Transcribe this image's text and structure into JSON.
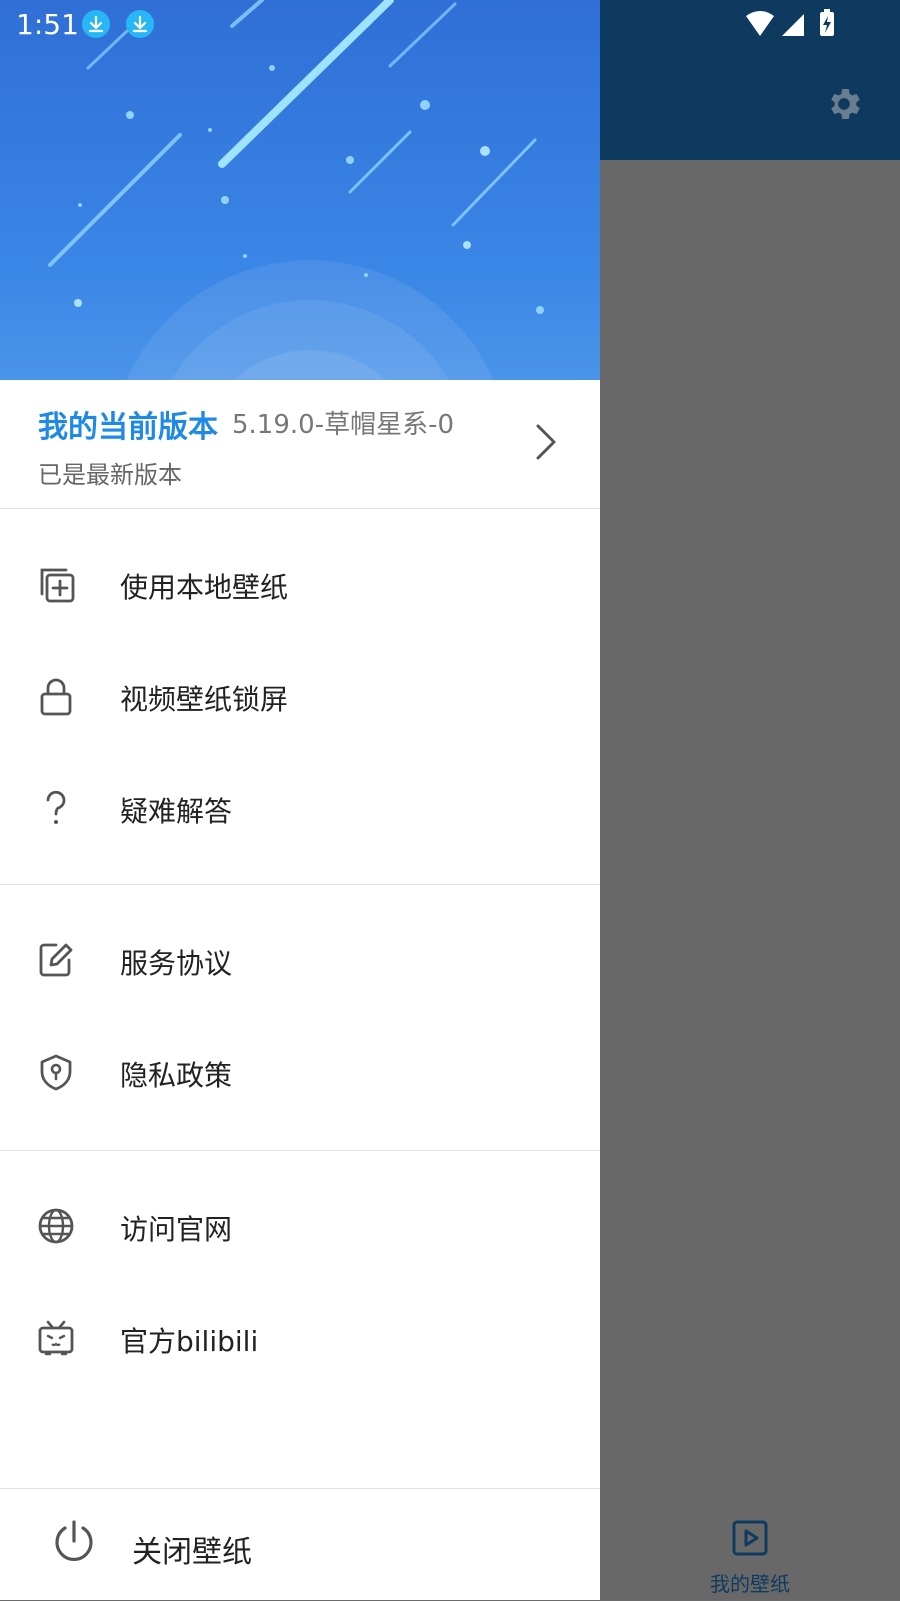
{
  "status_bar": {
    "time": "1:51"
  },
  "version": {
    "title": "我的当前版本",
    "number": "5.19.0-草帽星系-0",
    "status": "已是最新版本"
  },
  "menu": {
    "items": [
      {
        "label": "使用本地壁纸",
        "icon": "add-copy-icon"
      },
      {
        "label": "视频壁纸锁屏",
        "icon": "lock-icon"
      },
      {
        "label": "疑难解答",
        "icon": "question-icon"
      },
      {
        "label": "服务协议",
        "icon": "edit-document-icon"
      },
      {
        "label": "隐私政策",
        "icon": "shield-icon"
      },
      {
        "label": "访问官网",
        "icon": "globe-icon"
      },
      {
        "label": "官方bilibili",
        "icon": "bilibili-tv-icon"
      }
    ]
  },
  "close": {
    "label": "关闭壁纸"
  },
  "background_app": {
    "bottom_tab_label": "我的壁纸"
  },
  "colors": {
    "accent": "#1f8ae6",
    "topbar": "#0e3a5f",
    "scrim": "#686868"
  }
}
